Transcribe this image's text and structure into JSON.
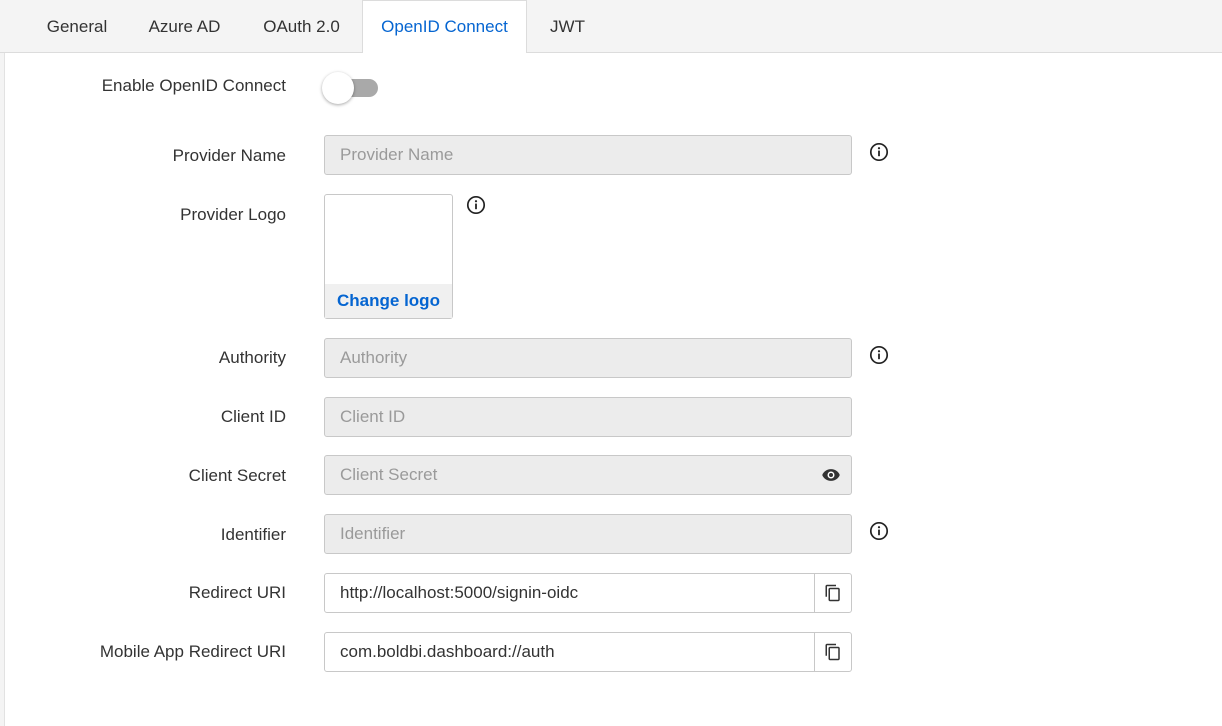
{
  "tabs": [
    {
      "label": "General"
    },
    {
      "label": "Azure AD"
    },
    {
      "label": "OAuth 2.0"
    },
    {
      "label": "OpenID Connect",
      "active": true
    },
    {
      "label": "JWT"
    }
  ],
  "enable": {
    "label": "Enable OpenID Connect",
    "on": false
  },
  "provider_name": {
    "label": "Provider Name",
    "placeholder": "Provider Name",
    "value": ""
  },
  "provider_logo": {
    "label": "Provider Logo",
    "change_label": "Change logo"
  },
  "authority": {
    "label": "Authority",
    "placeholder": "Authority",
    "value": ""
  },
  "client_id": {
    "label": "Client ID",
    "placeholder": "Client ID",
    "value": ""
  },
  "client_secret": {
    "label": "Client Secret",
    "placeholder": "Client Secret",
    "value": ""
  },
  "identifier": {
    "label": "Identifier",
    "placeholder": "Identifier",
    "value": ""
  },
  "redirect_uri": {
    "label": "Redirect URI",
    "value": "http://localhost:5000/signin-oidc"
  },
  "mobile_redirect_uri": {
    "label": "Mobile App Redirect URI",
    "value": "com.boldbi.dashboard://auth"
  },
  "icons": {
    "info": "info-icon",
    "eye": "eye-icon",
    "copy": "copy-icon"
  },
  "colors": {
    "accent": "#0565d1",
    "toggle_off": "#a9a9a9",
    "disabled_field": "#ececec"
  }
}
